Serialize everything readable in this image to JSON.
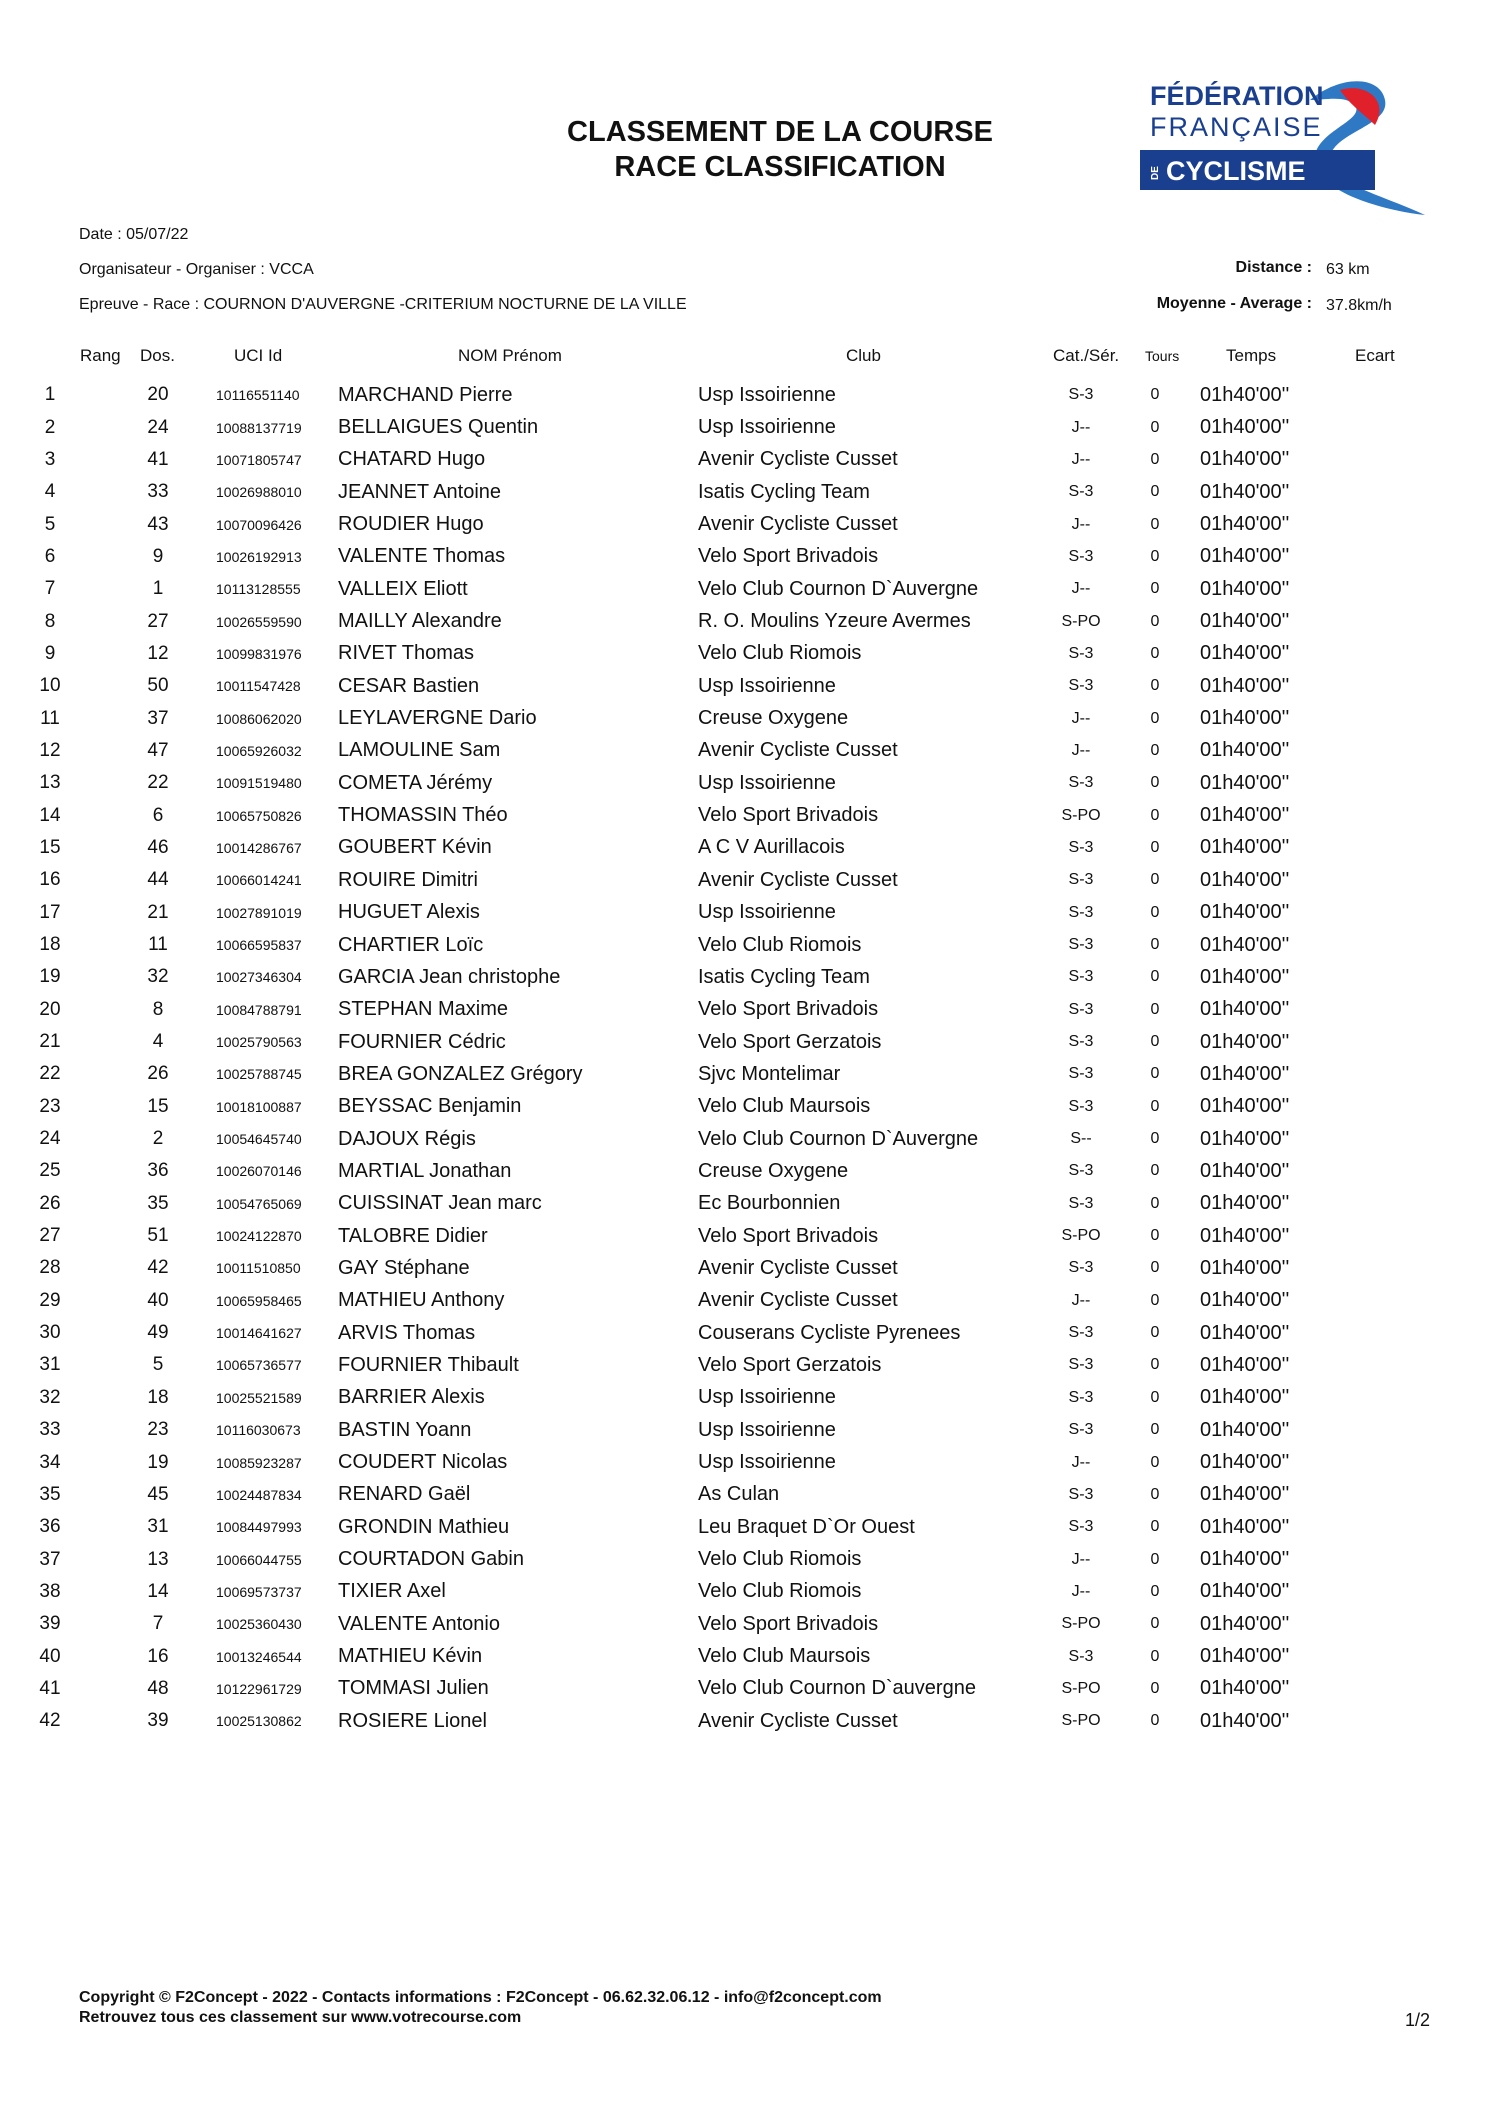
{
  "header": {
    "title_line1": "CLASSEMENT DE LA COURSE",
    "title_line2": "RACE CLASSIFICATION",
    "logo": {
      "line1": "FÉDÉRATION",
      "line2": "FRANÇAISE",
      "line3_prefix": "DE",
      "line3": "CYCLISME",
      "colors": {
        "blue_dark": "#1a3f8f",
        "blue_light": "#2f78c4",
        "red": "#e0202a"
      }
    }
  },
  "meta": {
    "date": "Date : 05/07/22",
    "organiser": "Organisateur - Organiser : VCCA",
    "race": "Epreuve - Race  : COURNON D'AUVERGNE -CRITERIUM NOCTURNE DE LA VILLE",
    "distance_label": "Distance :",
    "distance_value": "63 km",
    "average_label": "Moyenne - Average :",
    "average_value": "37.8km/h"
  },
  "columns": {
    "rang": "Rang",
    "dos": "Dos.",
    "uci": "UCI Id",
    "nom": "NOM Prénom",
    "club": "Club",
    "cat": "Cat./Sér.",
    "tours": "Tours",
    "temps": "Temps",
    "ecart": "Ecart"
  },
  "rows": [
    {
      "rang": "1",
      "dos": "20",
      "uci": "10116551140",
      "nom": "MARCHAND Pierre",
      "club": "Usp Issoirienne",
      "cat": "S-3",
      "tours": "0",
      "temps": "01h40'00''",
      "ecart": ""
    },
    {
      "rang": "2",
      "dos": "24",
      "uci": "10088137719",
      "nom": "BELLAIGUES Quentin",
      "club": "Usp Issoirienne",
      "cat": "J--",
      "tours": "0",
      "temps": "01h40'00''",
      "ecart": ""
    },
    {
      "rang": "3",
      "dos": "41",
      "uci": "10071805747",
      "nom": "CHATARD Hugo",
      "club": "Avenir Cycliste Cusset",
      "cat": "J--",
      "tours": "0",
      "temps": "01h40'00''",
      "ecart": ""
    },
    {
      "rang": "4",
      "dos": "33",
      "uci": "10026988010",
      "nom": "JEANNET Antoine",
      "club": "Isatis Cycling Team",
      "cat": "S-3",
      "tours": "0",
      "temps": "01h40'00''",
      "ecart": ""
    },
    {
      "rang": "5",
      "dos": "43",
      "uci": "10070096426",
      "nom": "ROUDIER Hugo",
      "club": "Avenir Cycliste Cusset",
      "cat": "J--",
      "tours": "0",
      "temps": "01h40'00''",
      "ecart": ""
    },
    {
      "rang": "6",
      "dos": "9",
      "uci": "10026192913",
      "nom": "VALENTE Thomas",
      "club": "Velo Sport Brivadois",
      "cat": "S-3",
      "tours": "0",
      "temps": "01h40'00''",
      "ecart": ""
    },
    {
      "rang": "7",
      "dos": "1",
      "uci": "10113128555",
      "nom": "VALLEIX Eliott",
      "club": "Velo Club Cournon D`Auvergne",
      "cat": "J--",
      "tours": "0",
      "temps": "01h40'00''",
      "ecart": ""
    },
    {
      "rang": "8",
      "dos": "27",
      "uci": "10026559590",
      "nom": "MAILLY Alexandre",
      "club": "R. O. Moulins Yzeure Avermes",
      "cat": "S-PO",
      "tours": "0",
      "temps": "01h40'00''",
      "ecart": ""
    },
    {
      "rang": "9",
      "dos": "12",
      "uci": "10099831976",
      "nom": "RIVET Thomas",
      "club": "Velo Club Riomois",
      "cat": "S-3",
      "tours": "0",
      "temps": "01h40'00''",
      "ecart": ""
    },
    {
      "rang": "10",
      "dos": "50",
      "uci": "10011547428",
      "nom": "CESAR Bastien",
      "club": "Usp Issoirienne",
      "cat": "S-3",
      "tours": "0",
      "temps": "01h40'00''",
      "ecart": ""
    },
    {
      "rang": "11",
      "dos": "37",
      "uci": "10086062020",
      "nom": "LEYLAVERGNE Dario",
      "club": "Creuse Oxygene",
      "cat": "J--",
      "tours": "0",
      "temps": "01h40'00''",
      "ecart": ""
    },
    {
      "rang": "12",
      "dos": "47",
      "uci": "10065926032",
      "nom": "LAMOULINE Sam",
      "club": "Avenir Cycliste Cusset",
      "cat": "J--",
      "tours": "0",
      "temps": "01h40'00''",
      "ecart": ""
    },
    {
      "rang": "13",
      "dos": "22",
      "uci": "10091519480",
      "nom": "COMETA Jérémy",
      "club": "Usp Issoirienne",
      "cat": "S-3",
      "tours": "0",
      "temps": "01h40'00''",
      "ecart": ""
    },
    {
      "rang": "14",
      "dos": "6",
      "uci": "10065750826",
      "nom": "THOMASSIN Théo",
      "club": "Velo Sport Brivadois",
      "cat": "S-PO",
      "tours": "0",
      "temps": "01h40'00''",
      "ecart": ""
    },
    {
      "rang": "15",
      "dos": "46",
      "uci": "10014286767",
      "nom": "GOUBERT Kévin",
      "club": "A C V Aurillacois",
      "cat": "S-3",
      "tours": "0",
      "temps": "01h40'00''",
      "ecart": ""
    },
    {
      "rang": "16",
      "dos": "44",
      "uci": "10066014241",
      "nom": "ROUIRE Dimitri",
      "club": "Avenir Cycliste Cusset",
      "cat": "S-3",
      "tours": "0",
      "temps": "01h40'00''",
      "ecart": ""
    },
    {
      "rang": "17",
      "dos": "21",
      "uci": "10027891019",
      "nom": "HUGUET Alexis",
      "club": "Usp Issoirienne",
      "cat": "S-3",
      "tours": "0",
      "temps": "01h40'00''",
      "ecart": ""
    },
    {
      "rang": "18",
      "dos": "11",
      "uci": "10066595837",
      "nom": "CHARTIER Loïc",
      "club": "Velo Club Riomois",
      "cat": "S-3",
      "tours": "0",
      "temps": "01h40'00''",
      "ecart": ""
    },
    {
      "rang": "19",
      "dos": "32",
      "uci": "10027346304",
      "nom": "GARCIA Jean christophe",
      "club": "Isatis Cycling Team",
      "cat": "S-3",
      "tours": "0",
      "temps": "01h40'00''",
      "ecart": ""
    },
    {
      "rang": "20",
      "dos": "8",
      "uci": "10084788791",
      "nom": "STEPHAN Maxime",
      "club": "Velo Sport Brivadois",
      "cat": "S-3",
      "tours": "0",
      "temps": "01h40'00''",
      "ecart": ""
    },
    {
      "rang": "21",
      "dos": "4",
      "uci": "10025790563",
      "nom": "FOURNIER Cédric",
      "club": "Velo Sport Gerzatois",
      "cat": "S-3",
      "tours": "0",
      "temps": "01h40'00''",
      "ecart": ""
    },
    {
      "rang": "22",
      "dos": "26",
      "uci": "10025788745",
      "nom": "BREA GONZALEZ Grégory",
      "club": "Sjvc Montelimar",
      "cat": "S-3",
      "tours": "0",
      "temps": "01h40'00''",
      "ecart": ""
    },
    {
      "rang": "23",
      "dos": "15",
      "uci": "10018100887",
      "nom": "BEYSSAC Benjamin",
      "club": "Velo Club Maursois",
      "cat": "S-3",
      "tours": "0",
      "temps": "01h40'00''",
      "ecart": ""
    },
    {
      "rang": "24",
      "dos": "2",
      "uci": "10054645740",
      "nom": "DAJOUX Régis",
      "club": "Velo Club Cournon D`Auvergne",
      "cat": "S--",
      "tours": "0",
      "temps": "01h40'00''",
      "ecart": ""
    },
    {
      "rang": "25",
      "dos": "36",
      "uci": "10026070146",
      "nom": "MARTIAL Jonathan",
      "club": "Creuse Oxygene",
      "cat": "S-3",
      "tours": "0",
      "temps": "01h40'00''",
      "ecart": ""
    },
    {
      "rang": "26",
      "dos": "35",
      "uci": "10054765069",
      "nom": "CUISSINAT Jean marc",
      "club": "Ec Bourbonnien",
      "cat": "S-3",
      "tours": "0",
      "temps": "01h40'00''",
      "ecart": ""
    },
    {
      "rang": "27",
      "dos": "51",
      "uci": "10024122870",
      "nom": "TALOBRE Didier",
      "club": "Velo Sport Brivadois",
      "cat": "S-PO",
      "tours": "0",
      "temps": "01h40'00''",
      "ecart": ""
    },
    {
      "rang": "28",
      "dos": "42",
      "uci": "10011510850",
      "nom": "GAY Stéphane",
      "club": "Avenir Cycliste Cusset",
      "cat": "S-3",
      "tours": "0",
      "temps": "01h40'00''",
      "ecart": ""
    },
    {
      "rang": "29",
      "dos": "40",
      "uci": "10065958465",
      "nom": "MATHIEU Anthony",
      "club": "Avenir Cycliste Cusset",
      "cat": "J--",
      "tours": "0",
      "temps": "01h40'00''",
      "ecart": ""
    },
    {
      "rang": "30",
      "dos": "49",
      "uci": "10014641627",
      "nom": "ARVIS Thomas",
      "club": "Couserans Cycliste Pyrenees",
      "cat": "S-3",
      "tours": "0",
      "temps": "01h40'00''",
      "ecart": ""
    },
    {
      "rang": "31",
      "dos": "5",
      "uci": "10065736577",
      "nom": "FOURNIER Thibault",
      "club": "Velo Sport Gerzatois",
      "cat": "S-3",
      "tours": "0",
      "temps": "01h40'00''",
      "ecart": ""
    },
    {
      "rang": "32",
      "dos": "18",
      "uci": "10025521589",
      "nom": "BARRIER Alexis",
      "club": "Usp Issoirienne",
      "cat": "S-3",
      "tours": "0",
      "temps": "01h40'00''",
      "ecart": ""
    },
    {
      "rang": "33",
      "dos": "23",
      "uci": "10116030673",
      "nom": "BASTIN Yoann",
      "club": "Usp Issoirienne",
      "cat": "S-3",
      "tours": "0",
      "temps": "01h40'00''",
      "ecart": ""
    },
    {
      "rang": "34",
      "dos": "19",
      "uci": "10085923287",
      "nom": "COUDERT Nicolas",
      "club": "Usp Issoirienne",
      "cat": "J--",
      "tours": "0",
      "temps": "01h40'00''",
      "ecart": ""
    },
    {
      "rang": "35",
      "dos": "45",
      "uci": "10024487834",
      "nom": "RENARD Gaël",
      "club": "As Culan",
      "cat": "S-3",
      "tours": "0",
      "temps": "01h40'00''",
      "ecart": ""
    },
    {
      "rang": "36",
      "dos": "31",
      "uci": "10084497993",
      "nom": "GRONDIN Mathieu",
      "club": "Leu Braquet D`Or Ouest",
      "cat": "S-3",
      "tours": "0",
      "temps": "01h40'00''",
      "ecart": ""
    },
    {
      "rang": "37",
      "dos": "13",
      "uci": "10066044755",
      "nom": "COURTADON Gabin",
      "club": "Velo Club Riomois",
      "cat": "J--",
      "tours": "0",
      "temps": "01h40'00''",
      "ecart": ""
    },
    {
      "rang": "38",
      "dos": "14",
      "uci": "10069573737",
      "nom": "TIXIER Axel",
      "club": "Velo Club Riomois",
      "cat": "J--",
      "tours": "0",
      "temps": "01h40'00''",
      "ecart": ""
    },
    {
      "rang": "39",
      "dos": "7",
      "uci": "10025360430",
      "nom": "VALENTE Antonio",
      "club": "Velo Sport Brivadois",
      "cat": "S-PO",
      "tours": "0",
      "temps": "01h40'00''",
      "ecart": ""
    },
    {
      "rang": "40",
      "dos": "16",
      "uci": "10013246544",
      "nom": "MATHIEU Kévin",
      "club": "Velo Club Maursois",
      "cat": "S-3",
      "tours": "0",
      "temps": "01h40'00''",
      "ecart": ""
    },
    {
      "rang": "41",
      "dos": "48",
      "uci": "10122961729",
      "nom": "TOMMASI Julien",
      "club": "Velo Club Cournon D`auvergne",
      "cat": "S-PO",
      "tours": "0",
      "temps": "01h40'00''",
      "ecart": ""
    },
    {
      "rang": "42",
      "dos": "39",
      "uci": "10025130862",
      "nom": "ROSIERE Lionel",
      "club": "Avenir Cycliste Cusset",
      "cat": "S-PO",
      "tours": "0",
      "temps": "01h40'00''",
      "ecart": ""
    }
  ],
  "footer": {
    "copyright": "Copyright © F2Concept - 2022 - Contacts informations : F2Concept - 06.62.32.06.12 - info@f2concept.com",
    "retrouvez": "Retrouvez tous ces classement sur www.votrecourse.com",
    "page": "1/2"
  }
}
